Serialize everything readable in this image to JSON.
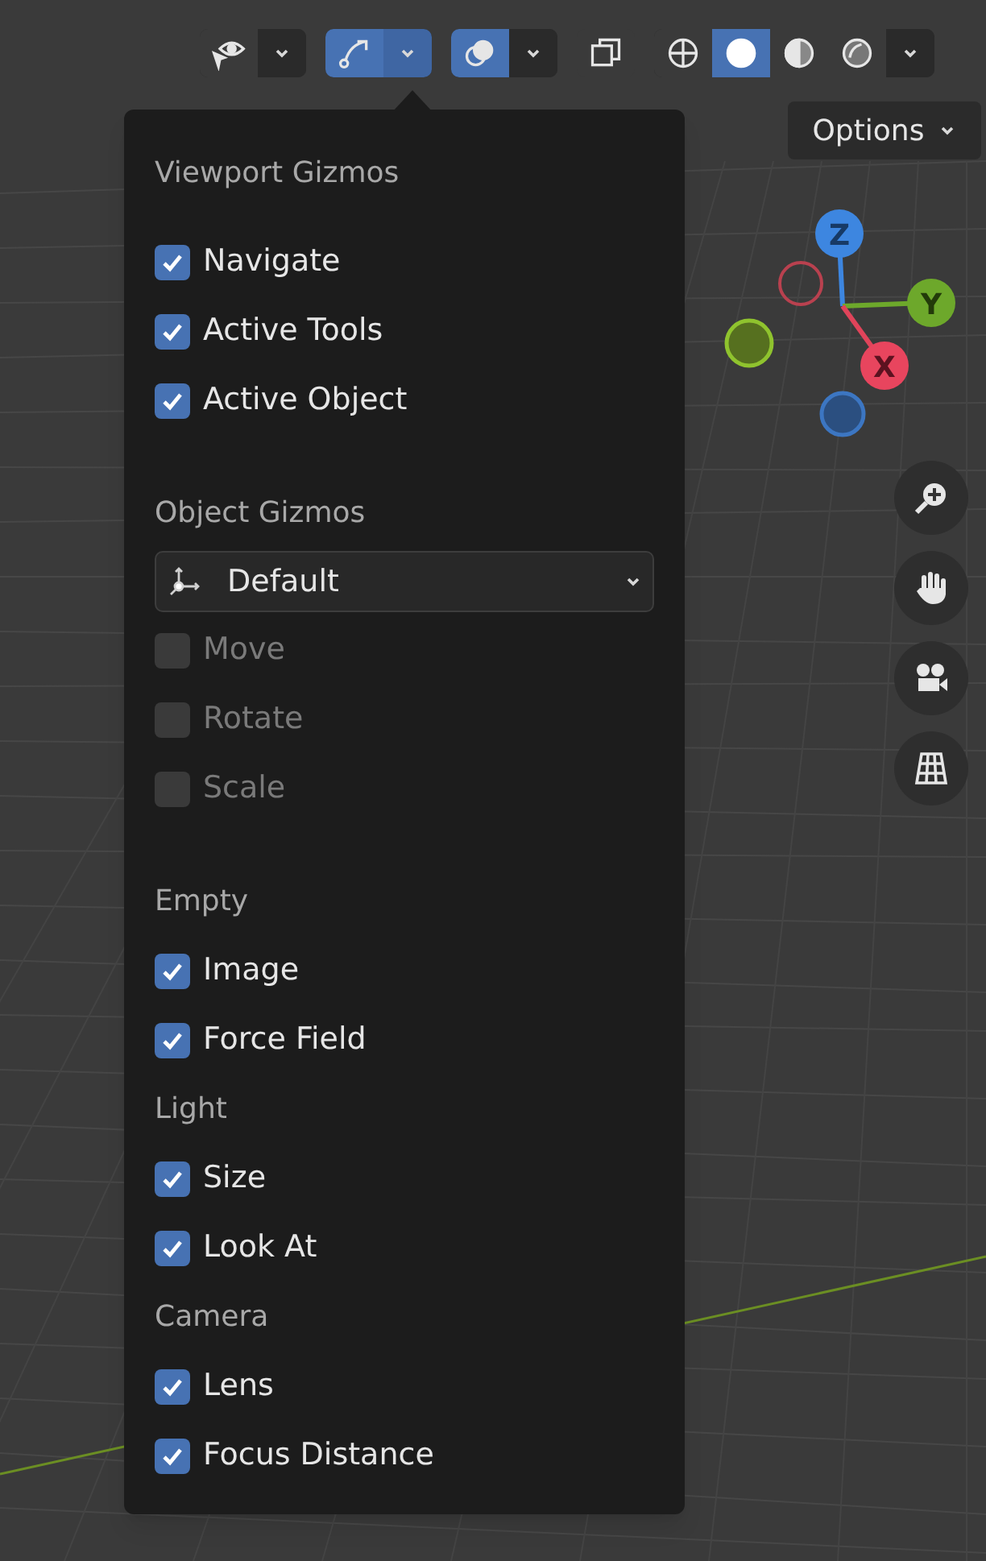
{
  "toolbar": [
    {
      "kind": "visibility",
      "selected": false
    },
    {
      "kind": "chevron",
      "selected": false
    },
    {
      "kind": "gizmo",
      "selected": true
    },
    {
      "kind": "chevron",
      "selected": true
    },
    {
      "kind": "overlay",
      "selected": true
    },
    {
      "kind": "chevron",
      "selected": false
    },
    {
      "kind": "xray",
      "selected": false
    },
    {
      "kind": "wireframe",
      "selected": false
    },
    {
      "kind": "solid",
      "selected": true
    },
    {
      "kind": "material",
      "selected": false
    },
    {
      "kind": "rendered",
      "selected": false
    },
    {
      "kind": "chevron",
      "selected": false
    }
  ],
  "options_button": {
    "label": "Options"
  },
  "popover": {
    "sections": [
      {
        "title": "Viewport Gizmos",
        "items": [
          {
            "label": "Navigate",
            "checked": true,
            "disabled": false
          },
          {
            "label": "Active Tools",
            "checked": true,
            "disabled": false
          },
          {
            "label": "Active Object",
            "checked": true,
            "disabled": false
          }
        ]
      },
      {
        "title": "Object Gizmos",
        "dropdown": {
          "value": "Default"
        },
        "items": [
          {
            "label": "Move",
            "checked": false,
            "disabled": true
          },
          {
            "label": "Rotate",
            "checked": false,
            "disabled": true
          },
          {
            "label": "Scale",
            "checked": false,
            "disabled": true
          }
        ]
      },
      {
        "title": "Empty",
        "items": [
          {
            "label": "Image",
            "checked": true,
            "disabled": false
          },
          {
            "label": "Force Field",
            "checked": true,
            "disabled": false
          }
        ]
      },
      {
        "title": "Light",
        "items": [
          {
            "label": "Size",
            "checked": true,
            "disabled": false
          },
          {
            "label": "Look At",
            "checked": true,
            "disabled": false
          }
        ]
      },
      {
        "title": "Camera",
        "items": [
          {
            "label": "Lens",
            "checked": true,
            "disabled": false
          },
          {
            "label": "Focus Distance",
            "checked": true,
            "disabled": false
          }
        ]
      }
    ]
  },
  "axis_gizmo": {
    "z": "Z",
    "y": "Y",
    "x": "X"
  },
  "nav_buttons": [
    {
      "kind": "zoom"
    },
    {
      "kind": "pan"
    },
    {
      "kind": "camera"
    },
    {
      "kind": "ortho"
    }
  ]
}
